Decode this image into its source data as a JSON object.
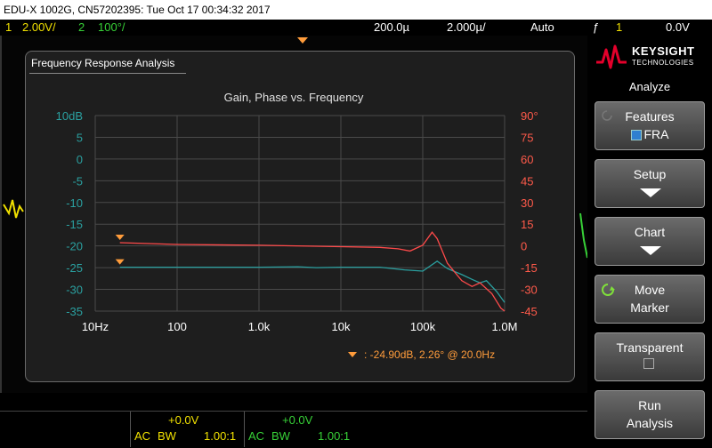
{
  "titlebar": "EDU-X 1002G, CN57202395: Tue Oct 17 00:34:32 2017",
  "status": {
    "ch1_num": "1",
    "ch1_scale": "2.00V/",
    "ch2_num": "2",
    "ch2_scale": "100°/",
    "timeref": "200.0µ",
    "timebase": "2.000µ/",
    "mode": "Auto",
    "trig_sym": "ƒ",
    "trig_ch": "1",
    "trig_level": "0.0V"
  },
  "panel": {
    "title": "Frequency Response Analysis",
    "legend_text": ": -24.90dB, 2.26° @ 20.0Hz"
  },
  "chart_data": {
    "type": "line",
    "title": "Gain, Phase vs. Frequency",
    "x_scale": "log",
    "x_ticks": [
      "10Hz",
      "100",
      "1.0k",
      "10k",
      "100k",
      "1.0M"
    ],
    "xlim": [
      10,
      1000000
    ],
    "y_left_ticks": [
      "10dB",
      "5",
      "0",
      "-5",
      "-10",
      "-15",
      "-20",
      "-25",
      "-30",
      "-35"
    ],
    "y_left_range": [
      -35,
      10
    ],
    "y_right_ticks": [
      "90°",
      "75",
      "60",
      "45",
      "30",
      "15",
      "0",
      "-15",
      "-30",
      "-45"
    ],
    "y_right_range": [
      -45,
      90
    ],
    "grid": true,
    "series": [
      {
        "axis": "left",
        "color": "#2aa0a0",
        "x": [
          20,
          100,
          1000,
          3000,
          5000,
          10000,
          30000,
          60000,
          100000,
          150000,
          200000,
          300000,
          400000,
          500000,
          600000,
          800000,
          1000000
        ],
        "y": [
          -24.9,
          -24.9,
          -24.9,
          -24.8,
          -25.0,
          -24.9,
          -24.9,
          -25.5,
          -25.8,
          -23.5,
          -25.2,
          -26.6,
          -27.7,
          -28.5,
          -28.0,
          -30.5,
          -33.0
        ]
      },
      {
        "axis": "right",
        "color": "#ff4a4a",
        "x": [
          20,
          100,
          1000,
          10000,
          30000,
          50000,
          70000,
          100000,
          130000,
          150000,
          200000,
          300000,
          400000,
          500000,
          700000,
          900000,
          1000000
        ],
        "y": [
          2.26,
          1.0,
          0.5,
          -0.5,
          -1.0,
          -2.0,
          -3.5,
          0.5,
          9.5,
          5.0,
          -12.0,
          -24.0,
          -28.0,
          -25.5,
          -33.0,
          -43.0,
          -45.0
        ]
      }
    ]
  },
  "bottom": {
    "ch1_offset": "+0.0V",
    "ch1_coupling": "AC",
    "ch1_bw": "BW",
    "ch1_probe": "1.00:1",
    "ch2_offset": "+0.0V",
    "ch2_coupling": "AC",
    "ch2_bw": "BW",
    "ch2_probe": "1.00:1"
  },
  "softkeys": {
    "brand": "KEYSIGHT",
    "brand_sub": "TECHNOLOGIES",
    "menu_title": "Analyze",
    "features_label": "Features",
    "features_value": "FRA",
    "setup_label": "Setup",
    "chart_label": "Chart",
    "move_label1": "Move",
    "move_label2": "Marker",
    "transparent_label": "Transparent",
    "run_label1": "Run",
    "run_label2": "Analysis"
  }
}
